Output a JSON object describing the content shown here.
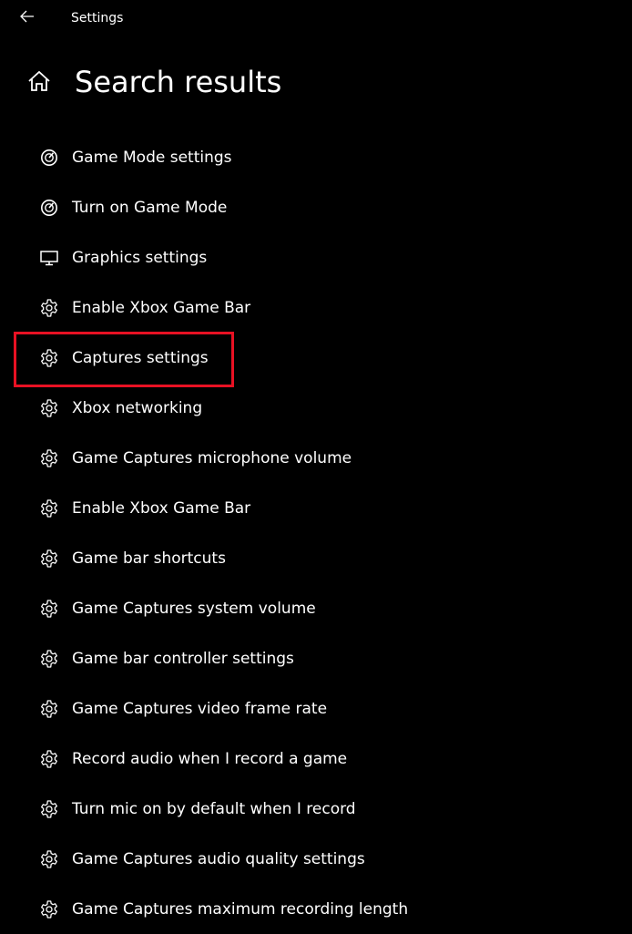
{
  "window": {
    "title": "Settings",
    "back_icon": "back-arrow-icon"
  },
  "header": {
    "title": "Search results",
    "home_icon": "home-icon"
  },
  "results": [
    {
      "label": "Game Mode settings",
      "icon": "gauge-icon"
    },
    {
      "label": "Turn on Game Mode",
      "icon": "gauge-icon"
    },
    {
      "label": "Graphics settings",
      "icon": "monitor-icon"
    },
    {
      "label": "Enable Xbox Game Bar",
      "icon": "gear-icon"
    },
    {
      "label": "Captures settings",
      "icon": "gear-icon",
      "highlighted": true
    },
    {
      "label": "Xbox networking",
      "icon": "gear-icon"
    },
    {
      "label": "Game Captures microphone volume",
      "icon": "gear-icon"
    },
    {
      "label": "Enable Xbox Game Bar",
      "icon": "gear-icon"
    },
    {
      "label": "Game bar shortcuts",
      "icon": "gear-icon"
    },
    {
      "label": "Game Captures system volume",
      "icon": "gear-icon"
    },
    {
      "label": "Game bar controller settings",
      "icon": "gear-icon"
    },
    {
      "label": "Game Captures video frame rate",
      "icon": "gear-icon"
    },
    {
      "label": "Record audio when I record a game",
      "icon": "gear-icon"
    },
    {
      "label": "Turn mic on by default when I record",
      "icon": "gear-icon"
    },
    {
      "label": "Game Captures audio quality settings",
      "icon": "gear-icon"
    },
    {
      "label": "Game Captures maximum recording length",
      "icon": "gear-icon"
    }
  ],
  "colors": {
    "background": "#000000",
    "text": "#ffffff",
    "highlight": "#e81123"
  }
}
